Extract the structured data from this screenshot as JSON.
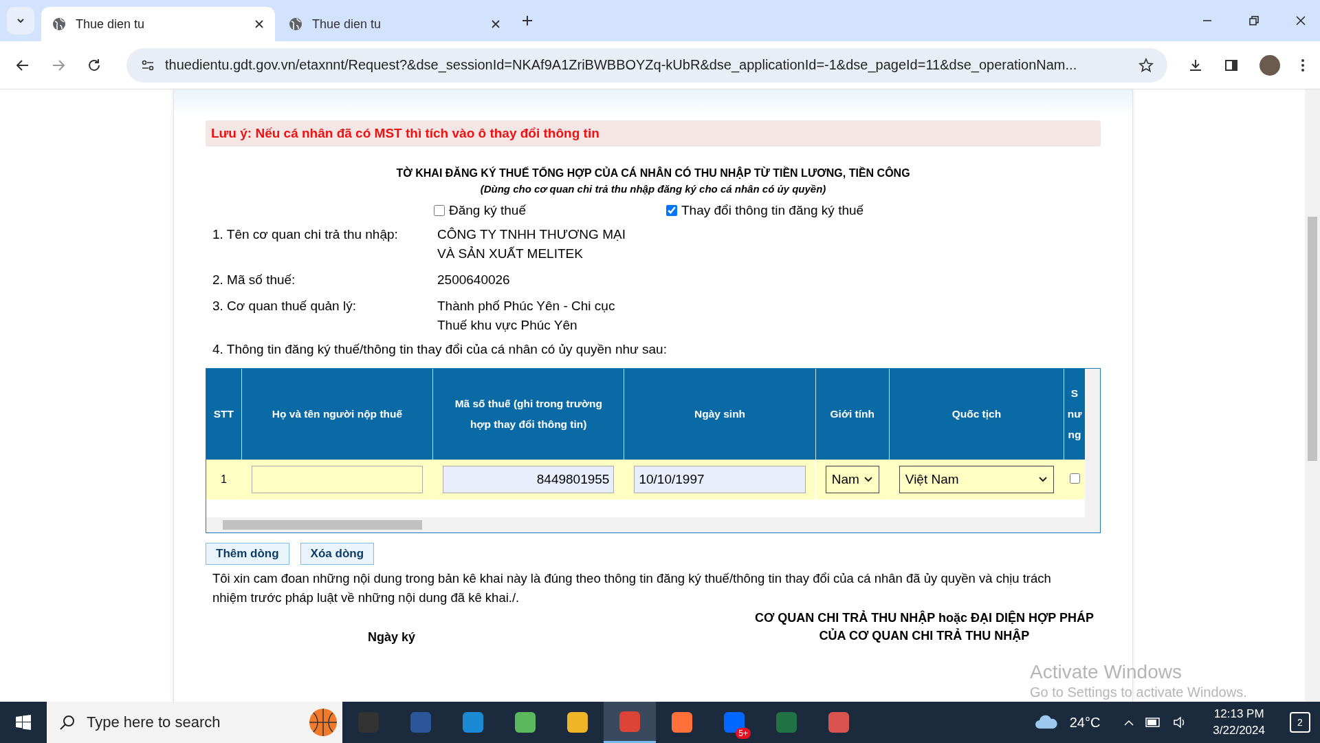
{
  "browser": {
    "tabs": [
      {
        "title": "Thue dien tu",
        "selected": true
      },
      {
        "title": "Thue dien tu",
        "selected": false
      }
    ],
    "url": "thuedientu.gdt.gov.vn/etaxnnt/Request?&dse_sessionId=NKAf9A1ZriBWBBOYZq-kUbR&dse_applicationId=-1&dse_pageId=11&dse_operationNam..."
  },
  "form": {
    "notice": "Lưu ý: Nếu cá nhân đã có MST thì tích vào ô thay đổi thông tin",
    "title": "TỜ KHAI ĐĂNG KÝ THUẾ TỔNG HỢP CỦA CÁ NHÂN CÓ THU NHẬP TỪ TIỀN LƯƠNG, TIỀN CÔNG",
    "subtitle": "(Dùng cho cơ quan chi trả thu nhập đăng ký cho cá nhân có ủy quyền)",
    "options": [
      {
        "label": "Đăng ký thuế",
        "checked": false
      },
      {
        "label": "Thay đổi thông tin đăng ký thuế",
        "checked": true
      }
    ],
    "fields": [
      {
        "label": "1. Tên cơ quan chi trả thu nhập:",
        "value_lines": [
          "CÔNG TY TNHH THƯƠNG MẠI",
          "VÀ SẢN XUẤT MELITEK"
        ]
      },
      {
        "label": "2. Mã số thuế:",
        "value_lines": [
          "2500640026"
        ]
      },
      {
        "label": "3. Cơ quan thuế quản lý:",
        "value_lines": [
          "Thành phố Phúc Yên - Chi cục",
          "Thuế khu vực Phúc Yên"
        ]
      }
    ],
    "section_4": "4. Thông tin đăng ký thuế/thông tin thay đổi của cá nhân có ủy quyền như sau:",
    "table": {
      "columns": [
        {
          "label_lines": [
            "STT"
          ]
        },
        {
          "label_lines": [
            "Họ và tên người nộp thuế"
          ]
        },
        {
          "label_lines": [
            "Mã số thuế (ghi trong trường",
            "hợp thay đổi thông tin)"
          ]
        },
        {
          "label_lines": [
            "Ngày sinh"
          ]
        },
        {
          "label_lines": [
            "Giới tính"
          ]
        },
        {
          "label_lines": [
            "Quốc tịch"
          ]
        },
        {
          "label_lines": [
            "S",
            "nư",
            "ng"
          ]
        }
      ],
      "rows": [
        {
          "cells": [
            {
              "kind": "text",
              "value": "1"
            },
            {
              "kind": "input"
            },
            {
              "kind": "input",
              "value": "8449801955"
            },
            {
              "kind": "input",
              "value": "10/10/1997"
            },
            {
              "kind": "select",
              "value": "Nam"
            },
            {
              "kind": "select",
              "value": "Việt Nam"
            },
            {
              "kind": "checkbox",
              "checked": false
            }
          ]
        }
      ]
    },
    "buttons": [
      "Thêm dòng",
      "Xóa dòng"
    ],
    "declaration": "Tôi xin cam đoan những nội dung trong bản kê khai này là đúng theo thông tin đăng ký thuế/thông tin thay đổi của cá nhân đã ủy quyền và chịu trách nhiệm trước pháp luật về những nội dung đã kê khai./.",
    "sign_date_label": "Ngày ký",
    "signer_lines": [
      "CƠ QUAN CHI TRẢ THU NHẬP hoặc ĐẠI DIỆN HỢP PHÁP",
      "CỦA CƠ QUAN CHI TRẢ THU NHẬP"
    ]
  },
  "activation": {
    "title": "Activate Windows",
    "subtitle": "Go to Settings to activate Windows."
  },
  "taskbar": {
    "search_placeholder": "Type here to search",
    "apps": [
      {
        "kind": "taskview",
        "active": false
      },
      {
        "kind": "word",
        "active": false
      },
      {
        "kind": "edge",
        "active": false
      },
      {
        "kind": "green",
        "active": false
      },
      {
        "kind": "folder",
        "active": false
      },
      {
        "kind": "chrome",
        "active": true
      },
      {
        "kind": "firefox",
        "active": false
      },
      {
        "kind": "zalo",
        "active": false,
        "badge": "5+"
      },
      {
        "kind": "excel",
        "active": false
      },
      {
        "kind": "game",
        "active": false
      }
    ],
    "temperature": "24°C",
    "time": "12:13 PM",
    "date": "3/22/2024",
    "notifications": "2"
  }
}
